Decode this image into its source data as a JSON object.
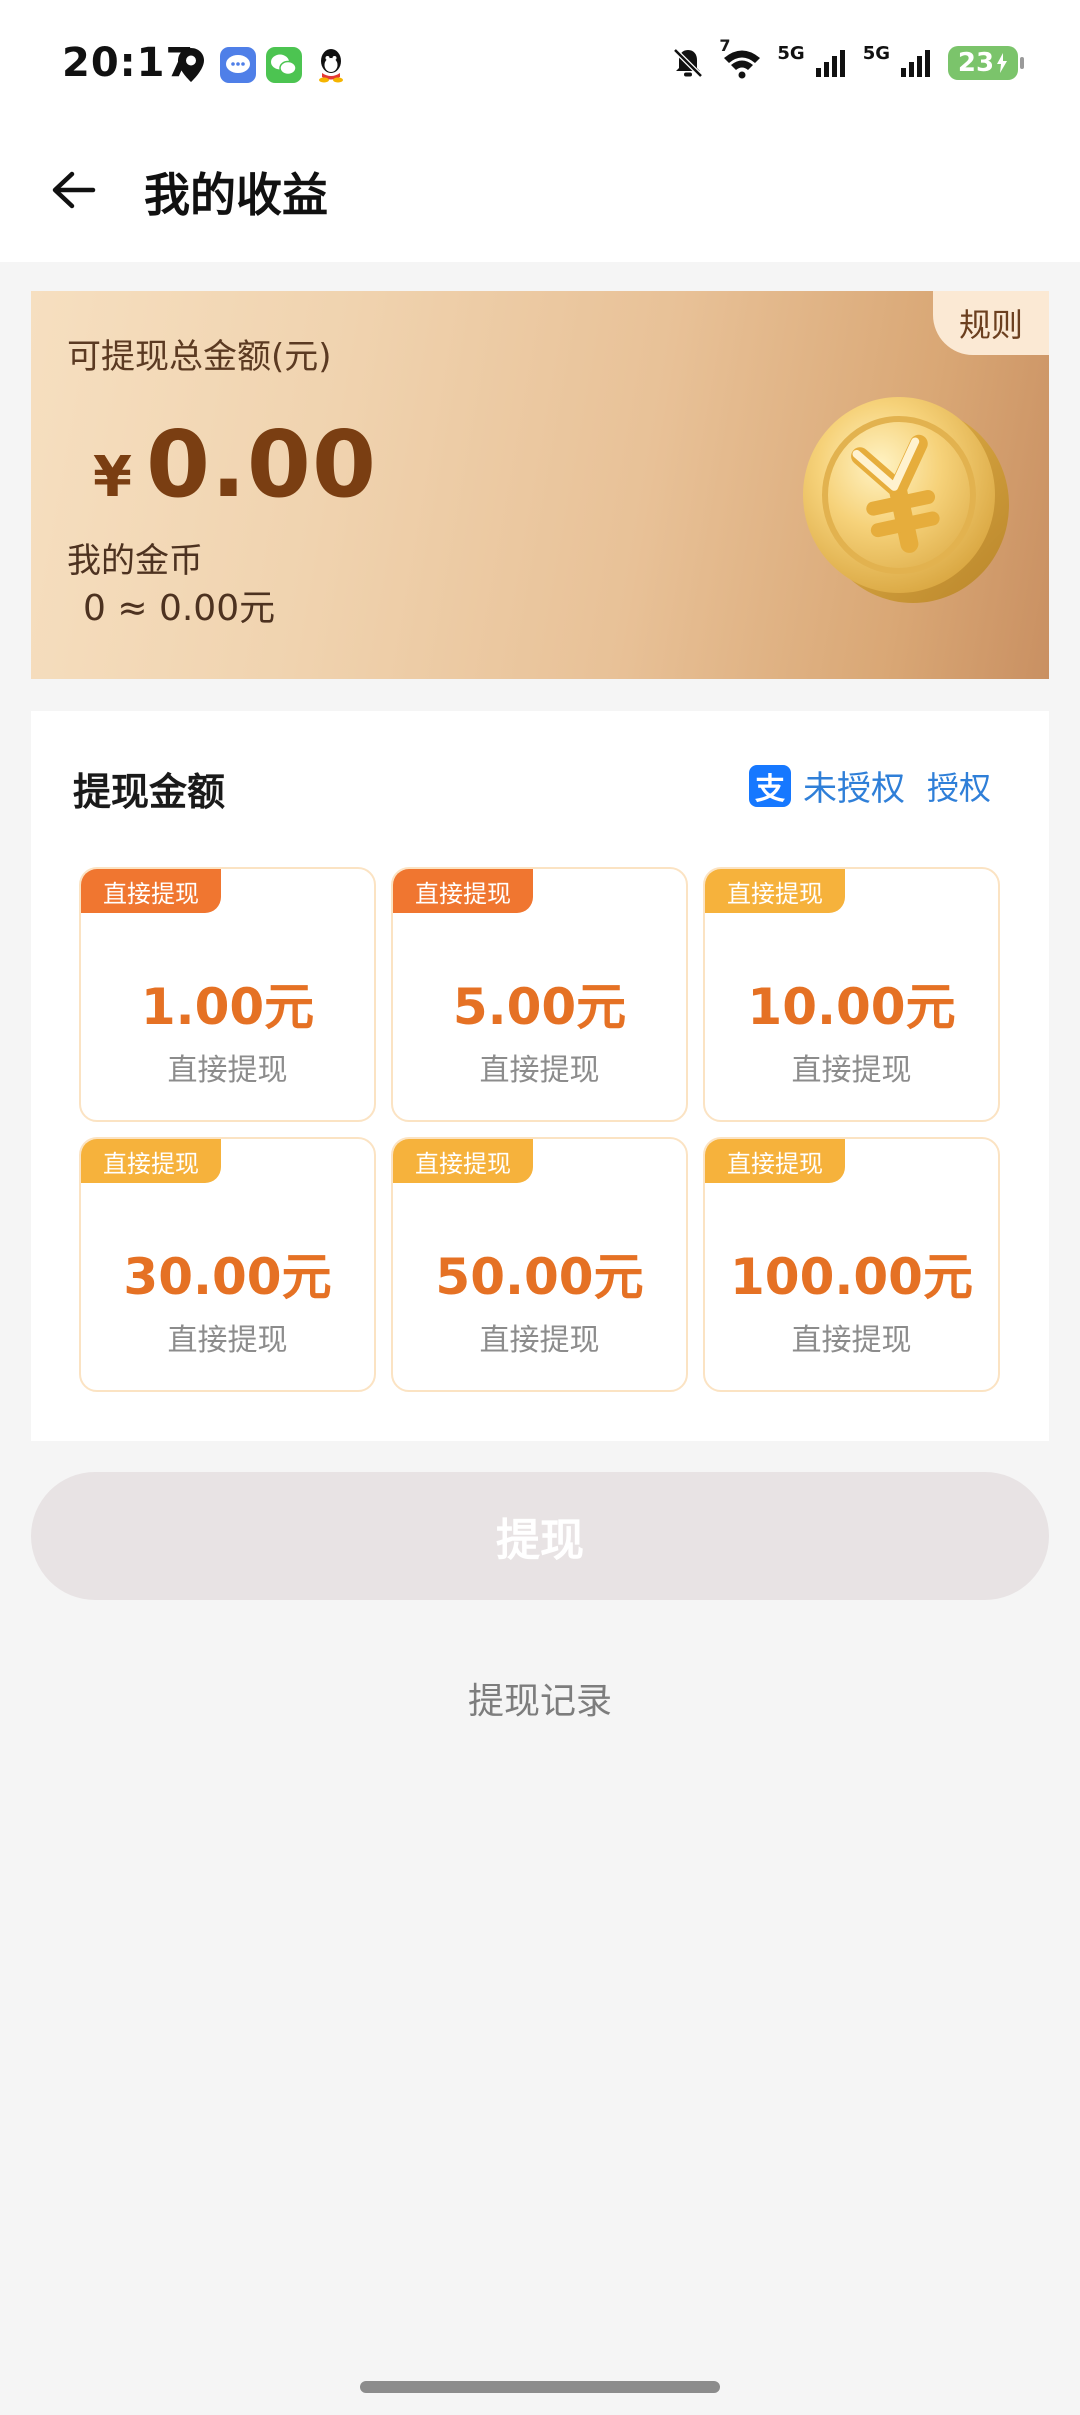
{
  "status_bar": {
    "time": "20:17",
    "battery": "23",
    "network_1": "5G",
    "network_2": "5G",
    "wifi_badge": "7",
    "left_icons": [
      "location-icon",
      "messages-app-icon",
      "wechat-app-icon",
      "qq-app-icon"
    ],
    "right_icons": [
      "mute-icon",
      "wifi-icon",
      "signal-icon",
      "signal-icon",
      "battery-charging-icon"
    ]
  },
  "header": {
    "title": "我的收益",
    "back_icon": "arrow-left-icon"
  },
  "earnings_card": {
    "rules_label": "规则",
    "total_label": "可提现总金额(元)",
    "currency_symbol": "¥",
    "total_amount": "0.00",
    "coins_label": "我的金币",
    "coins_value": "0 ≈ 0.00元",
    "coin_icon": "yuan-coin-icon"
  },
  "withdraw_panel": {
    "title": "提现金额",
    "auth_status": "未授权",
    "auth_action": "授权",
    "alipay_icon_glyph": "支",
    "options": [
      {
        "tag": "直接提现",
        "amount": "1.00元",
        "sub": "直接提现",
        "tag_color": "#f07630"
      },
      {
        "tag": "直接提现",
        "amount": "5.00元",
        "sub": "直接提现",
        "tag_color": "#f07630"
      },
      {
        "tag": "直接提现",
        "amount": "10.00元",
        "sub": "直接提现",
        "tag_color": "#f6b23c"
      },
      {
        "tag": "直接提现",
        "amount": "30.00元",
        "sub": "直接提现",
        "tag_color": "#f6b23c"
      },
      {
        "tag": "直接提现",
        "amount": "50.00元",
        "sub": "直接提现",
        "tag_color": "#f6b23c"
      },
      {
        "tag": "直接提现",
        "amount": "100.00元",
        "sub": "直接提现",
        "tag_color": "#f6b23c"
      }
    ]
  },
  "actions": {
    "withdraw_label": "提现",
    "records_label": "提现记录"
  },
  "colors": {
    "accent_orange": "#e57124",
    "auth_blue": "#2f7fd8",
    "disabled_button": "#e8e3e4"
  }
}
